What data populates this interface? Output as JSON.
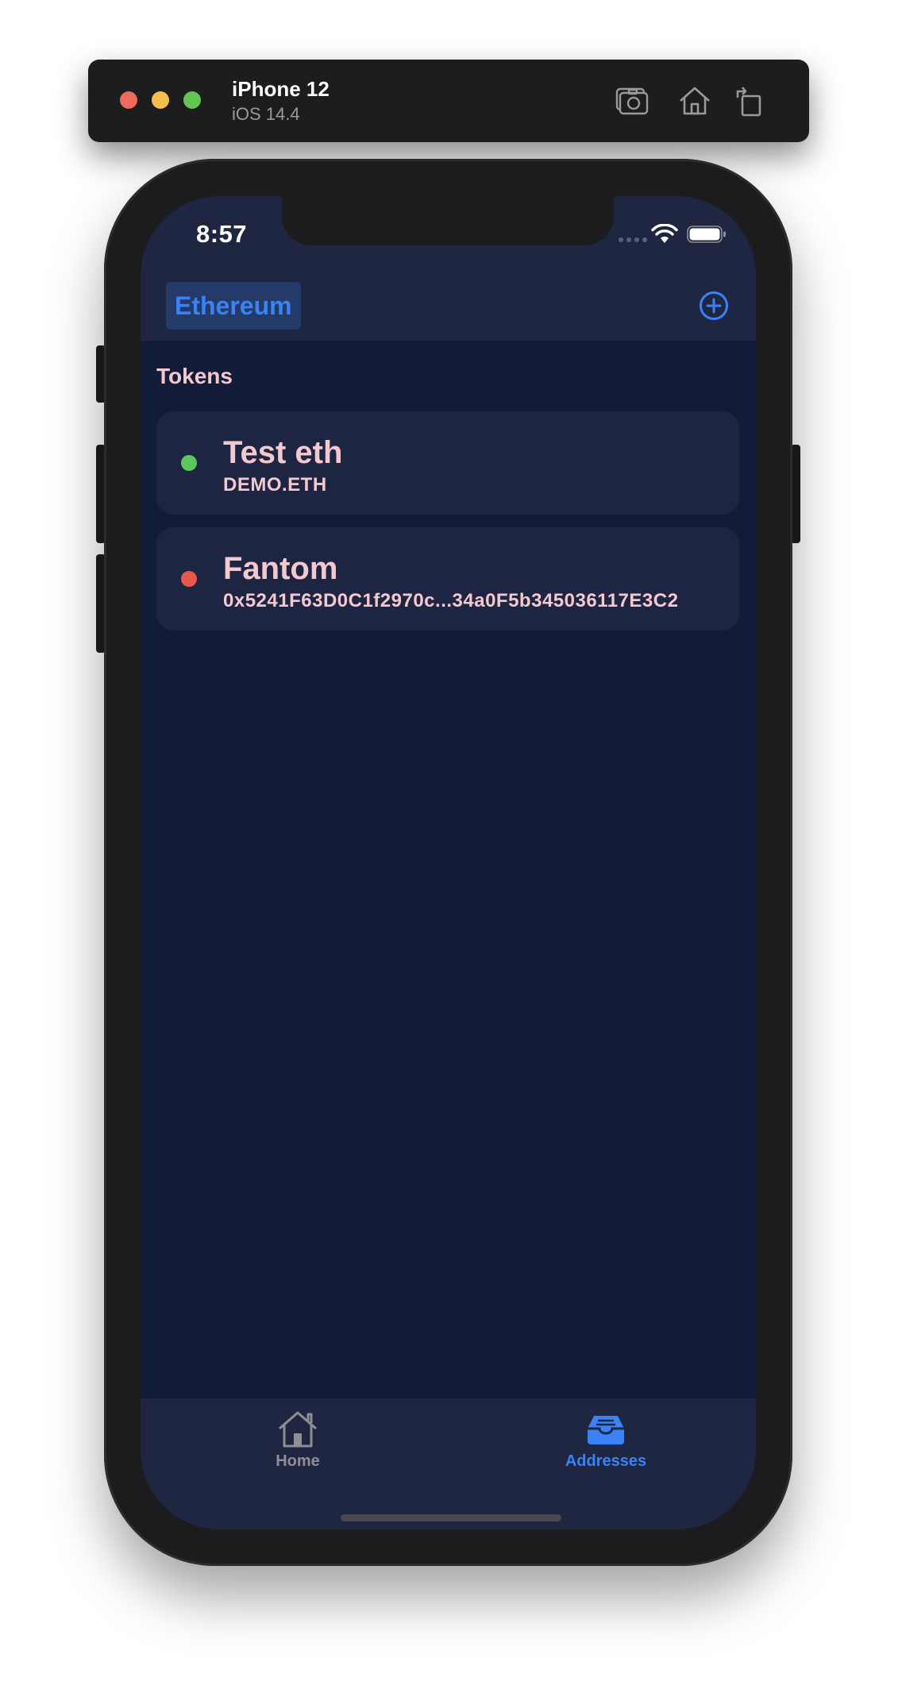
{
  "simulator": {
    "device_name": "iPhone 12",
    "os_version": "iOS 14.4",
    "buttons": [
      "screenshot-icon",
      "home-icon",
      "rotate-icon"
    ]
  },
  "status_bar": {
    "time": "8:57"
  },
  "nav": {
    "network_label": "Ethereum",
    "add_icon": "plus-circle-icon",
    "accent_color": "#3a83f6"
  },
  "content": {
    "section_title": "Tokens",
    "tokens": [
      {
        "name": "Test eth",
        "address": "DEMO.ETH",
        "status_color": "#5ac85a"
      },
      {
        "name": "Fantom",
        "address": "0x5241F63D0C1f2970c...34a0F5b345036117E3C2",
        "status_color": "#e5584a"
      }
    ]
  },
  "tab_bar": {
    "tabs": [
      {
        "label": "Home",
        "icon": "house-icon",
        "selected": false
      },
      {
        "label": "Addresses",
        "icon": "tray-icon",
        "selected": true
      }
    ]
  }
}
